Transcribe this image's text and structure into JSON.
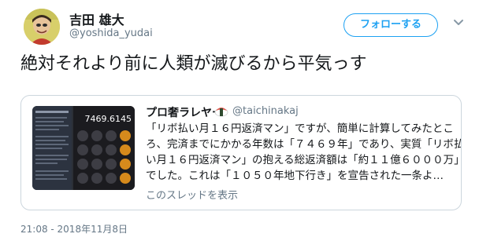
{
  "tweet": {
    "author_name": "吉田 雄大",
    "author_handle": "@yoshida_yudai",
    "text": "絶対それより前に人類が滅びるから平気っす",
    "follow_label": "フォローする",
    "timestamp": "21:08 - 2018年11月8日"
  },
  "quote": {
    "author_name": "プロ奢ラレヤー",
    "author_handle": "@taichinakaj",
    "lines": [
      "「リボ払い月１６円返済マン」ですが、簡単に計算してみたとこ",
      "ろ、完済までにかかる年数は「７４６９年」であり、実質「リボ払",
      "い月１６円返済マン」の抱える総返済額は「約１１億６０００万」",
      "でした。これは「１０５０年地下行き」を宣告された一条よ…"
    ],
    "thread_link": "このスレッドを表示",
    "thumbnail_number": "7469.6145"
  },
  "colors": {
    "accent": "#1da1f2",
    "text": "#14171a",
    "muted": "#657786",
    "border": "#ccd6dd"
  },
  "icons": {
    "avatar": "avatar-photo",
    "follow_icon": "bird-plus-icon",
    "menu": "chevron-down-icon",
    "badge": "sushi-icon"
  }
}
